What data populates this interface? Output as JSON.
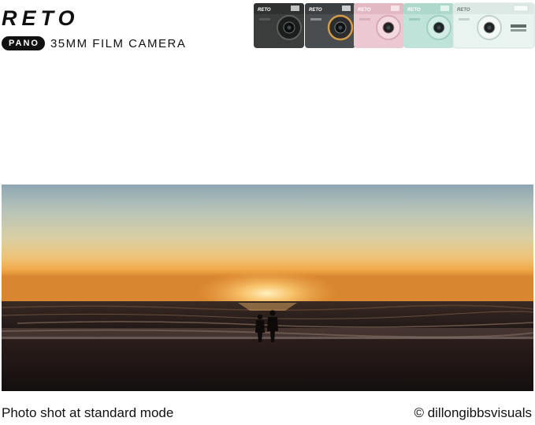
{
  "header": {
    "brand": "RETO",
    "badge": "PANO",
    "subtitle": "35MM FILM CAMERA"
  },
  "cameras": {
    "labels": [
      "RETO",
      "RETO",
      "RETO",
      "RETO",
      "RETO"
    ],
    "colors": [
      "#3a3d3c",
      "#4a4d4f",
      "#ecc9d2",
      "#bfe3d9",
      "#e9f3ef"
    ]
  },
  "photo": {
    "subject": "beach-sunset-two-silhouettes"
  },
  "footer": {
    "caption": "Photo shot at standard mode",
    "credit": "© dillongibbsvisuals"
  }
}
